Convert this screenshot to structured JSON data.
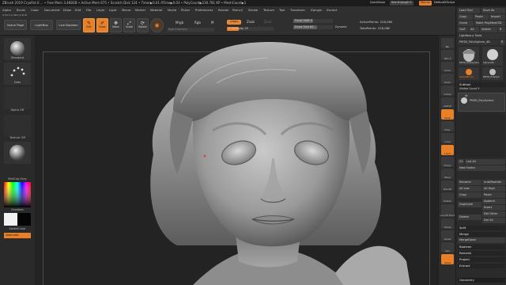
{
  "title_bar": {
    "text": "ZBrush 2019    CryoRst.0 ...  • Free Mem 3.468GB • Active Mem 675 • Scratch Disk 124 • Timer▶0.01 ATime▶0.03 • PolyCount▶230.781 KP • MeshCount▶1",
    "quicksave": "QuickSave",
    "seethrough": "See-through  0",
    "menus": "Menus",
    "default_zscript": "DefaultZScript"
  },
  "menubar": [
    "Alpha",
    "Brush",
    "Color",
    "Document",
    "Draw",
    "Edit",
    "File",
    "Layer",
    "Light",
    "Macro",
    "Marker",
    "Material",
    "Movie",
    "Picker",
    "Preferences",
    "Render",
    "Stencil",
    "Stroke",
    "Texture",
    "Tool",
    "Transform",
    "Zplugin",
    "Zscript"
  ],
  "coords_readout": "0.825,0.480,0.876",
  "toolbar": {
    "home_page": "Home Page",
    "lightbox": "LightBox",
    "live_boolean": "Live Boolean",
    "edit": "Edit",
    "draw": "Draw",
    "move": "Move",
    "scale": "Scale",
    "rotate": "Rotate",
    "mrgb": "Mrgb",
    "rgb": "Rgb",
    "m": "M",
    "zadd": "Zadd",
    "zsub": "Zsub",
    "zcut": "Zcut",
    "rgb_intensity": "Rgb Intensity",
    "z_intensity": "Z Intensity 25",
    "focal_shift": "Focal Shift 0",
    "draw_size": "Draw Size 64",
    "dynamic": "Dynamic",
    "active_points": "ActivePoints: 228,080",
    "total_points": "TotalPoints: 228,080"
  },
  "left_panel": {
    "brush_label": "Standard",
    "stroke_label": "Dots",
    "alpha_label": "Alpha Off",
    "texture_label": "Texture Off",
    "material_label": "MatCap Gray",
    "gradient_label": "Gradient",
    "switch_color": "SwitchColor",
    "alternate": "Alternate"
  },
  "right_shelf": [
    "Bpr",
    "SPix 3",
    "Scroll",
    "Zoom",
    "Actual",
    "AAHalf",
    "Persp",
    "Floor",
    "Local",
    "L.Sym",
    "Frame",
    "Move",
    "ZoomD",
    "Rotate",
    "Line Fill PolyF",
    "Transp",
    "Ghost",
    "Solo",
    "Xpose"
  ],
  "right_panel": {
    "load_tool": "Load Tool",
    "save_as": "Save As",
    "copy": "Copy",
    "paste": "Paste",
    "import": "Import",
    "export": "Export",
    "clone": "Clone",
    "make_polymesh": "Make PolyMesh3D",
    "goz": "GoZ",
    "all": "All",
    "visible": "Visible",
    "r": "R",
    "lightbox_tools": "Lightbox ▸ Tools",
    "current_tool": "PM3D_PolySphere_4B",
    "r_toggle": "R",
    "thumb1": "PM3D_PolySphere",
    "thumb2": "Sphere3D",
    "thumb3": "SimpleBrush",
    "thumb4": "PM3D_PolySph",
    "subtool_header": "Subtool",
    "visible_count": "Visible Count 5",
    "subtool_item": "PM3D_PolySphere",
    "v1": "V1",
    "list_all": "List All",
    "new_folder": "New Folder",
    "rename": "Rename",
    "autoreorder": "AutoReorder",
    "all_low": "All Low",
    "all_high": "All High",
    "copy2": "Copy",
    "paste2": "Paste",
    "duplicate": "Duplicate",
    "append": "Append",
    "insert": "Insert",
    "delete": "Delete",
    "del_other": "Del Other",
    "del_all": "Del All",
    "split": "Split",
    "merge": "Merge",
    "mergedown": "MergeDown",
    "boolean": "Boolean",
    "remesh": "Remesh",
    "project": "Project",
    "extract": "Extract",
    "geometry": "Geometry"
  }
}
